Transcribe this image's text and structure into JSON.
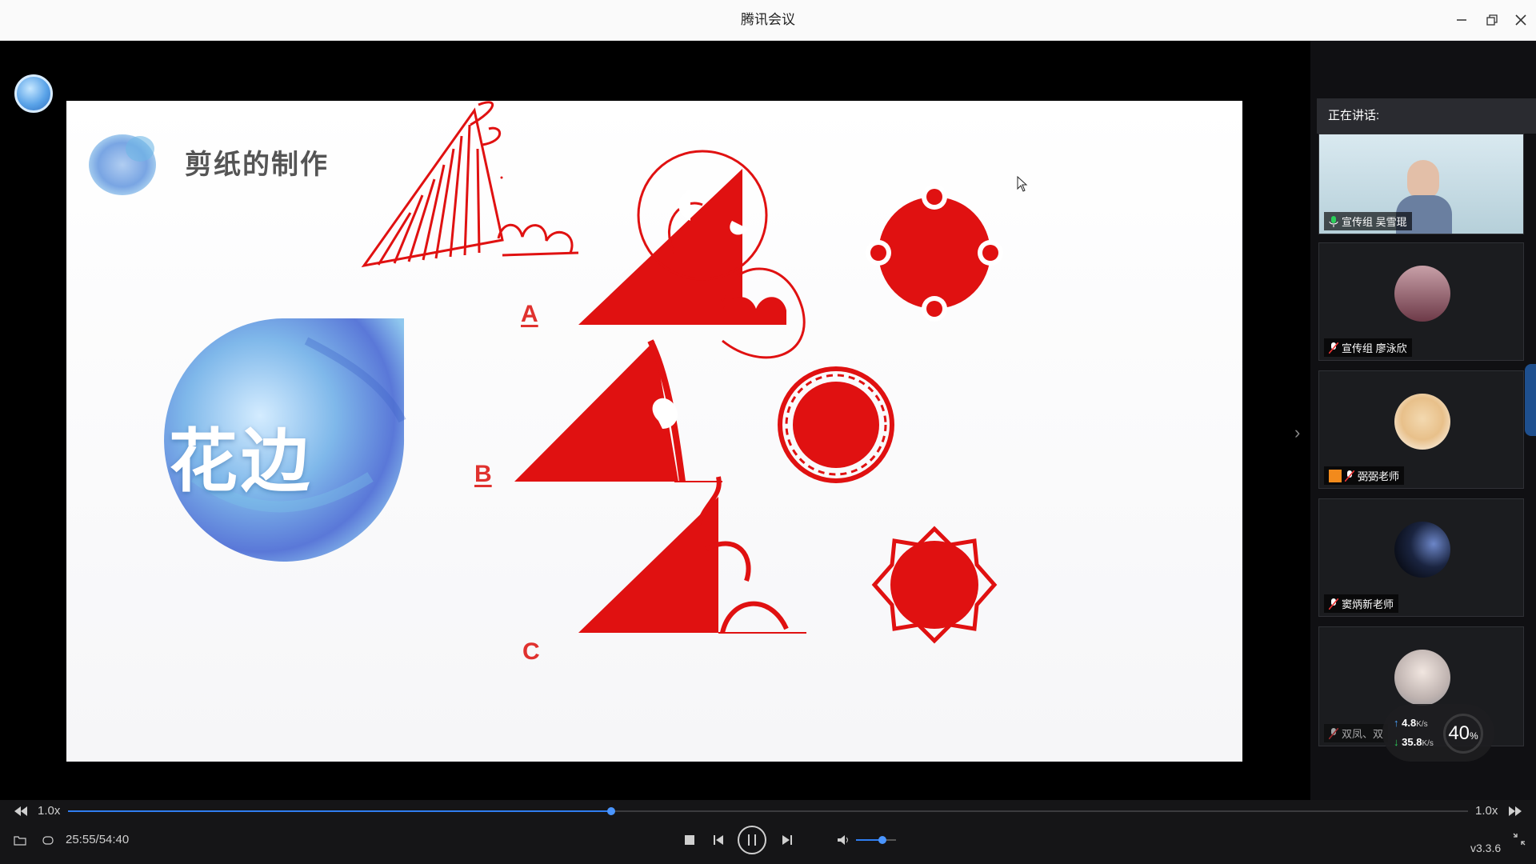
{
  "window": {
    "title": "腾讯会议"
  },
  "slide": {
    "title": "剪纸的制作",
    "blob_text": "花边",
    "options": [
      "A",
      "B",
      "C"
    ]
  },
  "sidebar": {
    "speaking_label": "正在讲话:",
    "participants": [
      {
        "name": "宣传组 吴雪琨",
        "mic": "on"
      },
      {
        "name": "宣传组 廖泳欣",
        "mic": "muted"
      },
      {
        "name": "弼弼老师",
        "mic": "muted"
      },
      {
        "name": "窦炳新老师",
        "mic": "muted"
      },
      {
        "name": "双凤、双",
        "mic": "muted"
      }
    ]
  },
  "network": {
    "upload": "4.8",
    "download": "35.8",
    "unit": "K/s",
    "percent": "40",
    "percent_unit": "%"
  },
  "player": {
    "speed_left": "1.0x",
    "speed_right": "1.0x",
    "time": "25:55/54:40",
    "version": "v3.3.6",
    "progress": 0.388,
    "volume": 0.65
  },
  "colors": {
    "accent": "#2f7df0",
    "paper_red": "#e01111"
  }
}
